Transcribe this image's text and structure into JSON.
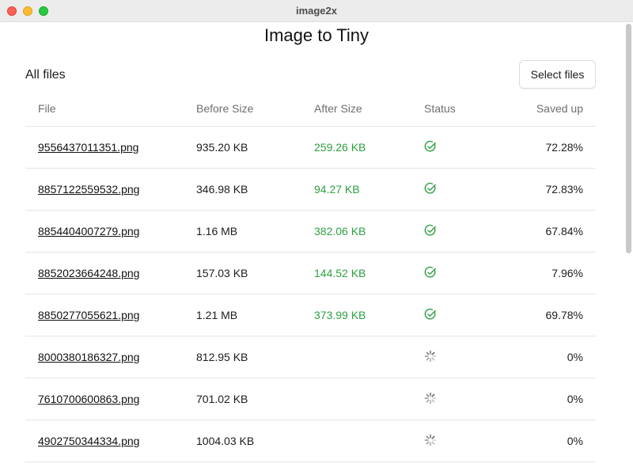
{
  "window": {
    "title": "image2x"
  },
  "app": {
    "title": "Image to Tiny"
  },
  "section": {
    "title": "All files"
  },
  "actions": {
    "select_files": "Select files"
  },
  "colors": {
    "success": "#2ea043",
    "spinner": "#666666"
  },
  "table": {
    "headers": {
      "file": "File",
      "before": "Before Size",
      "after": "After Size",
      "status": "Status",
      "saved": "Saved up"
    },
    "rows": [
      {
        "file": "9556437011351.png",
        "before": "935.20 KB",
        "after": "259.26 KB",
        "status": "done",
        "saved": "72.28%"
      },
      {
        "file": "8857122559532.png",
        "before": "346.98 KB",
        "after": "94.27 KB",
        "status": "done",
        "saved": "72.83%"
      },
      {
        "file": "8854404007279.png",
        "before": "1.16 MB",
        "after": "382.06 KB",
        "status": "done",
        "saved": "67.84%"
      },
      {
        "file": "8852023664248.png",
        "before": "157.03 KB",
        "after": "144.52 KB",
        "status": "done",
        "saved": "7.96%"
      },
      {
        "file": "8850277055621.png",
        "before": "1.21 MB",
        "after": "373.99 KB",
        "status": "done",
        "saved": "69.78%"
      },
      {
        "file": "8000380186327.png",
        "before": "812.95 KB",
        "after": "",
        "status": "loading",
        "saved": "0%"
      },
      {
        "file": "7610700600863.png",
        "before": "701.02 KB",
        "after": "",
        "status": "loading",
        "saved": "0%"
      },
      {
        "file": "4902750344334.png",
        "before": "1004.03 KB",
        "after": "",
        "status": "loading",
        "saved": "0%"
      }
    ]
  }
}
